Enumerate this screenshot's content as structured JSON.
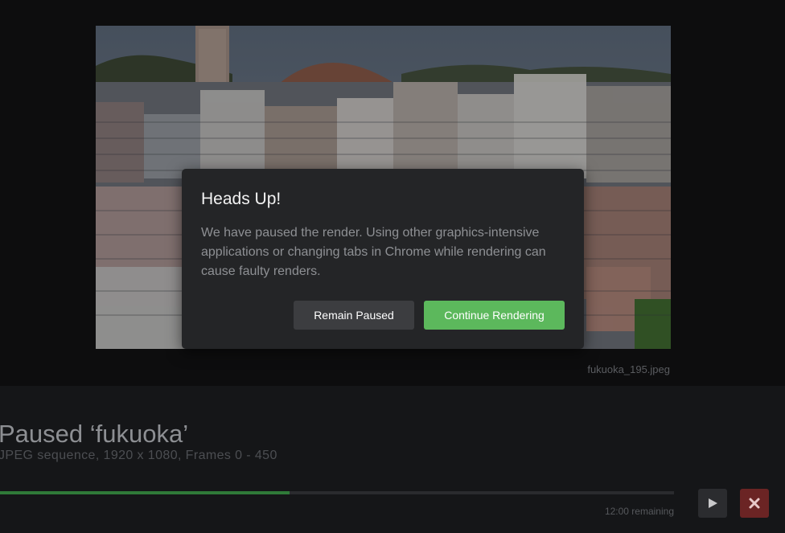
{
  "preview": {
    "filename": "fukuoka_195.jpeg"
  },
  "job": {
    "title": "Paused ‘fukuoka’",
    "subtitle": "JPEG sequence, 1920 x 1080, Frames 0 - 450",
    "progress_percent": 43,
    "remaining": "12:00 remaining"
  },
  "controls": {
    "play_icon": "play-icon",
    "stop_icon": "close-icon",
    "stop_color": "#6b2424"
  },
  "modal": {
    "title": "Heads Up!",
    "body": "We have paused the render. Using other graphics-intensive applications or changing tabs in Chrome while rendering can cause faulty renders.",
    "remain_label": "Remain Paused",
    "continue_label": "Continue Rendering",
    "continue_color": "#5cb85c"
  }
}
